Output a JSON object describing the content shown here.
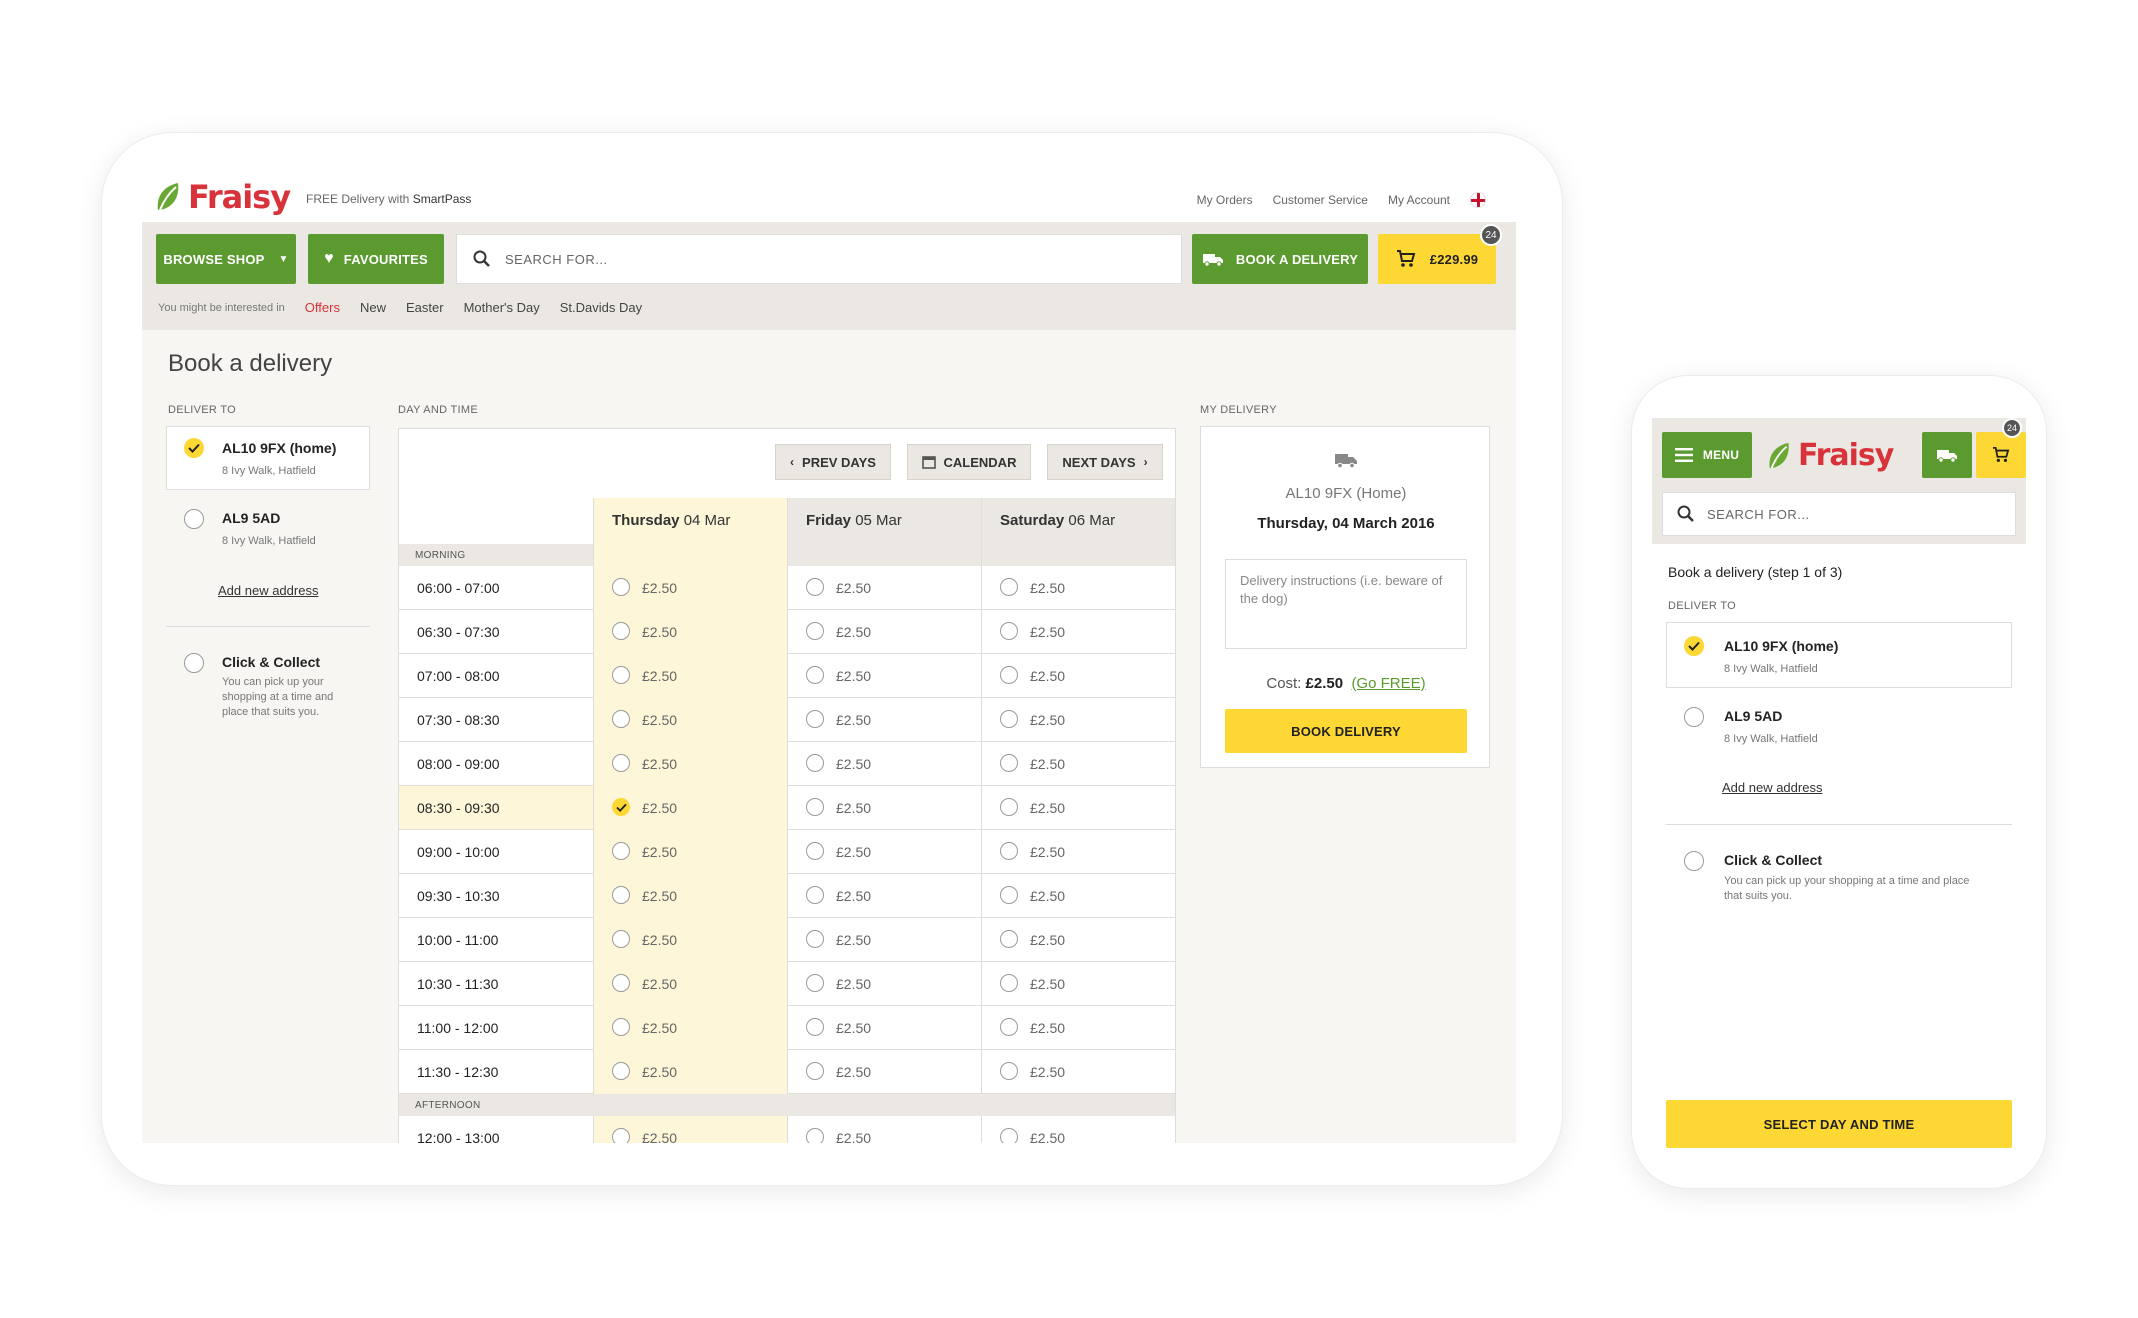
{
  "brand": {
    "name": "Fraisy",
    "accent_green": "#5a9a2e",
    "accent_yellow": "#fdd835",
    "brand_red": "#d8323a"
  },
  "desktop": {
    "promo_prefix": "FREE Delivery with",
    "promo_strong": "SmartPass",
    "top_links": [
      "My Orders",
      "Customer Service",
      "My Account"
    ],
    "browse_shop": "BROWSE SHOP",
    "favourites": "FAVOURITES",
    "search_placeholder": "SEARCH FOR...",
    "book_delivery": "BOOK A DELIVERY",
    "cart_total": "£229.99",
    "cart_count": "24",
    "interest_label": "You might be interested in",
    "interest_links": [
      "Offers",
      "New",
      "Easter",
      "Mother's Day",
      "St.Davids Day"
    ],
    "page_title": "Book a delivery",
    "deliver_to_label": "DELIVER TO",
    "addresses": [
      {
        "name": "AL10 9FX (home)",
        "line": "8 Ivy Walk, Hatfield",
        "selected": true
      },
      {
        "name": "AL9 5AD",
        "line": "8 Ivy Walk, Hatfield",
        "selected": false
      }
    ],
    "add_address": "Add new address",
    "click_collect": {
      "title": "Click & Collect",
      "desc_lines": [
        "You can pick up your",
        "shopping at a time and",
        "place that suits you."
      ]
    },
    "day_time_label": "DAY AND TIME",
    "prev_days": "PREV DAYS",
    "calendar": "CALENDAR",
    "next_days": "NEXT DAYS",
    "days": [
      {
        "day": "Thursday",
        "date": "04 Mar"
      },
      {
        "day": "Friday",
        "date": "05 Mar"
      },
      {
        "day": "Saturday",
        "date": "06 Mar"
      }
    ],
    "morning_label": "MORNING",
    "afternoon_label": "AFTERNOON",
    "price": "£2.50",
    "morning_slots": [
      "06:00 - 07:00",
      "06:30 - 07:30",
      "07:00 - 08:00",
      "07:30 - 08:30",
      "08:00 - 09:00",
      "08:30 - 09:30",
      "09:00 - 10:00",
      "09:30 - 10:30",
      "10:00 - 11:00",
      "10:30 - 11:30",
      "11:00 - 12:00",
      "11:30 - 12:30"
    ],
    "afternoon_slots": [
      "12:00 - 13:00"
    ],
    "selected_slot": {
      "day_index": 0,
      "slot": "08:30 - 09:30"
    },
    "my_delivery_label": "MY DELIVERY",
    "my_delivery": {
      "address": "AL10 9FX (Home)",
      "date": "Thursday, 04 March 2016",
      "instructions_placeholder": "Delivery instructions (i.e. beware of the dog)",
      "cost_label": "Cost:",
      "cost": "£2.50",
      "go_free": "(Go FREE)",
      "book_button": "BOOK DELIVERY"
    }
  },
  "mobile": {
    "menu": "MENU",
    "search_placeholder": "SEARCH FOR...",
    "cart_count": "24",
    "step_title": "Book a delivery (step 1 of 3)",
    "deliver_to_label": "DELIVER TO",
    "addresses": [
      {
        "name": "AL10 9FX (home)",
        "line": "8 Ivy Walk, Hatfield",
        "selected": true
      },
      {
        "name": "AL9 5AD",
        "line": "8 Ivy Walk, Hatfield",
        "selected": false
      }
    ],
    "add_address": "Add new address",
    "click_collect": {
      "title": "Click & Collect",
      "desc_lines": [
        "You can pick up your shopping at a time and place",
        "that suits you."
      ]
    },
    "select_button": "SELECT DAY AND TIME"
  }
}
